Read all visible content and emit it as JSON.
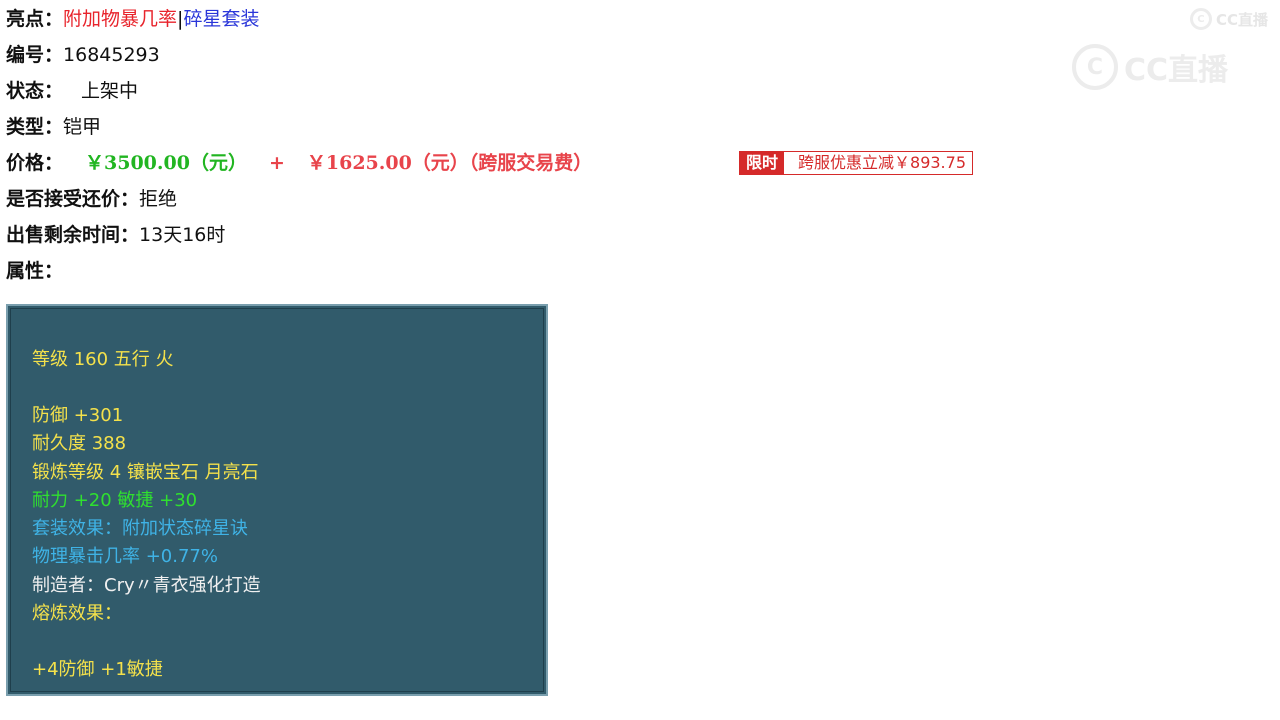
{
  "highlight": {
    "label": "亮点：",
    "red_text": "附加物暴几率",
    "separator": "|",
    "blue_text": "碎星套装"
  },
  "serial": {
    "label": "编号：",
    "value": "16845293"
  },
  "status": {
    "label": "状态：",
    "value": "上架中"
  },
  "type": {
    "label": "类型：",
    "value": "铠甲"
  },
  "price": {
    "label": "价格：",
    "base": "￥3500.00（元）",
    "plus": "+",
    "fee": "￥1625.00（元）（跨服交易费）",
    "badge_tag": "限时",
    "badge_text": "跨服优惠立减￥893.75"
  },
  "bargain": {
    "label": "是否接受还价：",
    "value": "拒绝"
  },
  "time_left": {
    "label": "出售剩余时间：",
    "value": "13天16时"
  },
  "attributes_label": "属性：",
  "attributes": {
    "level_line": "等级 160 五行 火",
    "defense": "防御 +301",
    "durability": "耐久度 388",
    "forge": "锻炼等级 4 镶嵌宝石 月亮石",
    "stats": "耐力 +20 敏捷 +30",
    "set_effect": "套装效果：附加状态碎星诀",
    "crit": "物理暴击几率 +0.77%",
    "maker": "制造者：Cry〃青衣强化打造",
    "smelt_label": "熔炼效果：",
    "smelt_value": "+4防御 +1敏捷"
  },
  "watermark": {
    "top_text": "CC直播",
    "main_text": "CC直播"
  },
  "colors": {
    "highlight_red": "#e8232b",
    "highlight_blue": "#2a36d9",
    "price_green": "#21b521",
    "price_red": "#e8444b",
    "panel_bg": "#315b6b",
    "attr_yellow": "#f4e14b",
    "attr_green": "#2fe02f",
    "attr_cyan": "#3fb3e6"
  }
}
